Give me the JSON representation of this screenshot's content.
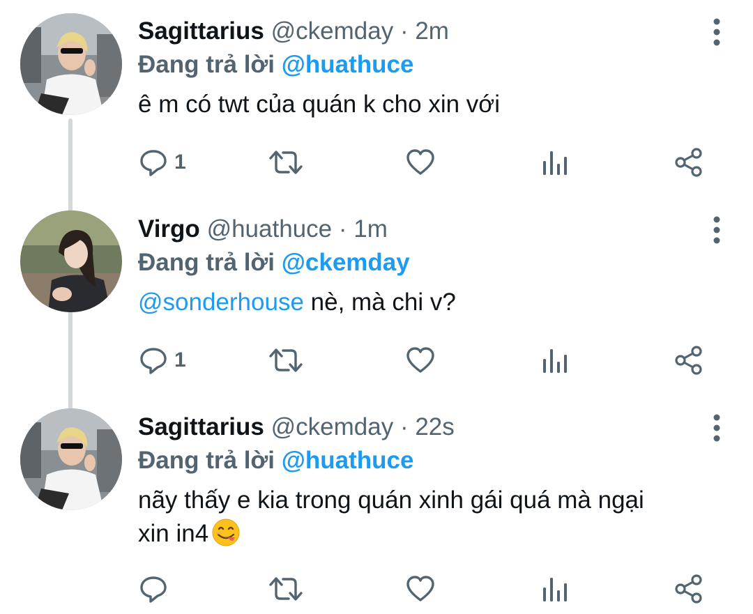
{
  "tweets": [
    {
      "name": "Sagittarius",
      "handle": "@ckemday",
      "separator": "·",
      "time": "2m",
      "reply_prefix": "Đang trả lời",
      "reply_to": "@huathuce",
      "text": "ê m có twt của quán k cho xin với",
      "reply_count": "1",
      "avatar": "sagittarius-avatar"
    },
    {
      "name": "Virgo",
      "handle": "@huathuce",
      "separator": "·",
      "time": "1m",
      "reply_prefix": "Đang trả lời",
      "reply_to": "@ckemday",
      "text_mention": "@sonderhouse",
      "text": " nè, mà chi v?",
      "reply_count": "1",
      "avatar": "virgo-avatar"
    },
    {
      "name": "Sagittarius",
      "handle": "@ckemday",
      "separator": "·",
      "time": "22s",
      "reply_prefix": "Đang trả lời",
      "reply_to": "@huathuce",
      "text_line1": "nãy thấy e kia trong quán xinh gái quá mà ngại",
      "text_line2": "xin in4",
      "emoji": "face-savoring-food-emoji",
      "reply_count": "",
      "avatar": "sagittarius-avatar"
    }
  ],
  "icons": {
    "reply": "reply-icon",
    "retweet": "retweet-icon",
    "like": "heart-icon",
    "views": "views-icon",
    "share": "share-icon",
    "more": "more-icon"
  },
  "colors": {
    "mention": "#1d9bf0",
    "muted": "#536471",
    "text": "#0f1419",
    "thread_line": "#d4d8dc"
  }
}
